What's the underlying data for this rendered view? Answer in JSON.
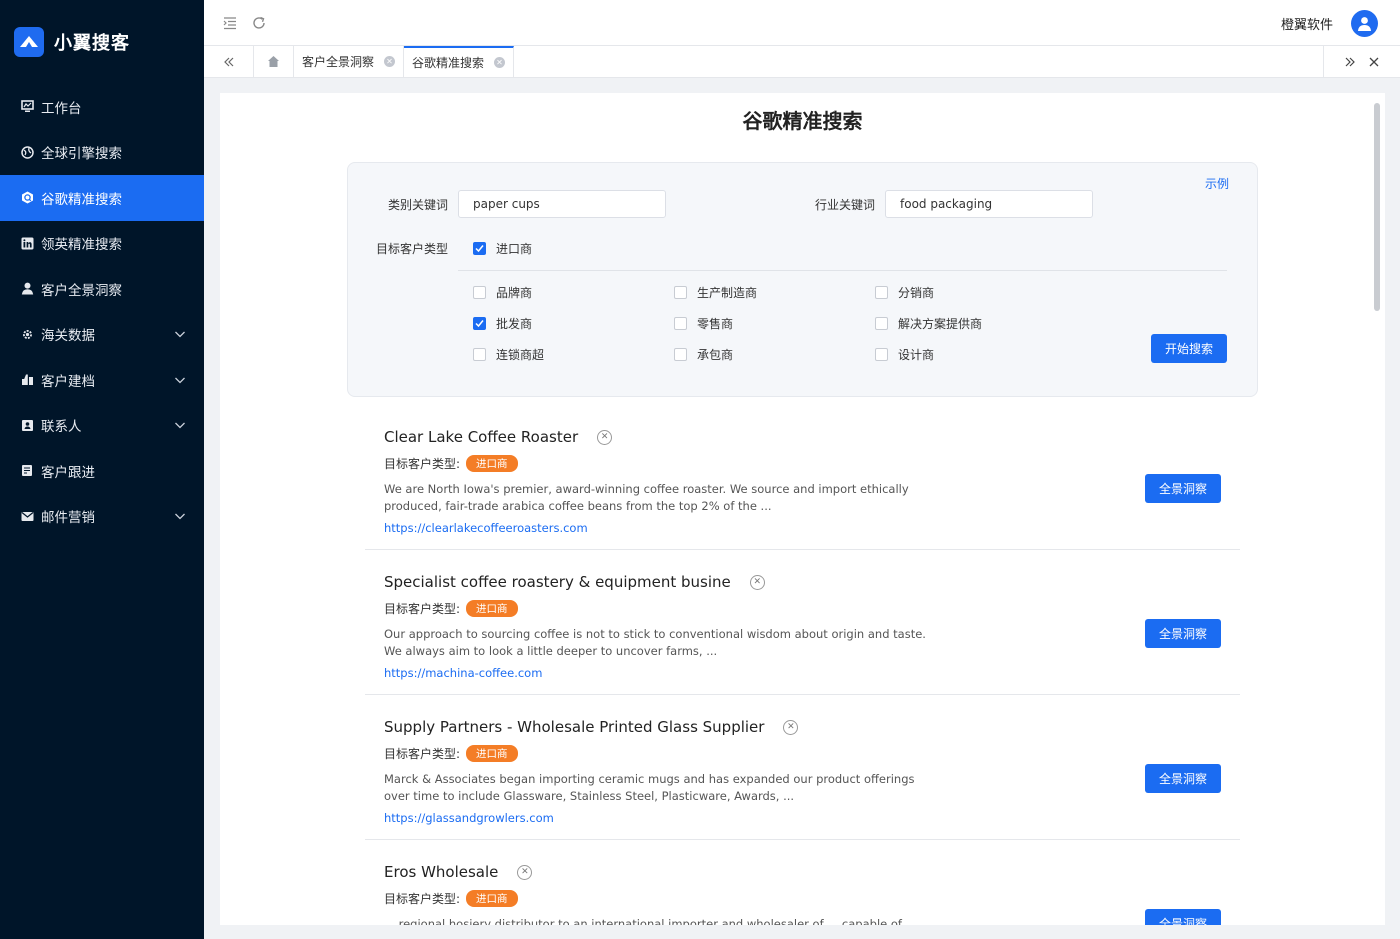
{
  "app": {
    "name": "小翼搜客",
    "company": "橙翼软件"
  },
  "sidebar": {
    "items": [
      {
        "label": "工作台",
        "icon": "monitor-icon",
        "expandable": false,
        "active": false
      },
      {
        "label": "全球引擎搜索",
        "icon": "globe-icon",
        "expandable": false,
        "active": false
      },
      {
        "label": "谷歌精准搜索",
        "icon": "google-icon",
        "expandable": false,
        "active": true
      },
      {
        "label": "领英精准搜索",
        "icon": "linkedin-icon",
        "expandable": false,
        "active": false
      },
      {
        "label": "客户全景洞察",
        "icon": "user-icon",
        "expandable": false,
        "active": false
      },
      {
        "label": "海关数据",
        "icon": "gear-icon",
        "expandable": true,
        "active": false
      },
      {
        "label": "客户建档",
        "icon": "archive-icon",
        "expandable": true,
        "active": false
      },
      {
        "label": "联系人",
        "icon": "contact-icon",
        "expandable": true,
        "active": false
      },
      {
        "label": "客户跟进",
        "icon": "follow-icon",
        "expandable": false,
        "active": false
      },
      {
        "label": "邮件营销",
        "icon": "mail-icon",
        "expandable": true,
        "active": false
      }
    ]
  },
  "tabs": [
    {
      "label": "客户全景洞察",
      "active": false
    },
    {
      "label": "谷歌精准搜索",
      "active": true
    }
  ],
  "page": {
    "title": "谷歌精准搜索",
    "example_link": "示例"
  },
  "form": {
    "category_label": "类别关键词",
    "category_value": "paper cups",
    "industry_label": "行业关键词",
    "industry_value": "food packaging",
    "target_label": "目标客户类型",
    "primary_type": {
      "label": "进口商",
      "checked": true
    },
    "types": [
      {
        "label": "品牌商",
        "checked": false
      },
      {
        "label": "生产制造商",
        "checked": false
      },
      {
        "label": "分销商",
        "checked": false
      },
      {
        "label": "批发商",
        "checked": true
      },
      {
        "label": "零售商",
        "checked": false
      },
      {
        "label": "解决方案提供商",
        "checked": false
      },
      {
        "label": "连锁商超",
        "checked": false
      },
      {
        "label": "承包商",
        "checked": false
      },
      {
        "label": "设计商",
        "checked": false
      }
    ],
    "search_button": "开始搜索"
  },
  "results": [
    {
      "title": "Clear Lake Coffee Roaster",
      "type_label": "目标客户类型:",
      "badge": "进口商",
      "desc": "We are North Iowa's premier, award-winning coffee roaster. We source and import ethically produced, fair-trade arabica coffee beans from the top 2% of the ...",
      "url": "https://clearlakecoffeeroasters.com",
      "button": "全景洞察"
    },
    {
      "title": "Specialist coffee roastery & equipment busine",
      "type_label": "目标客户类型:",
      "badge": "进口商",
      "desc": "Our approach to sourcing coffee is not to stick to conventional wisdom about origin and taste. We always aim to look a little deeper to uncover farms, ...",
      "url": "https://machina-coffee.com",
      "button": "全景洞察"
    },
    {
      "title": "Supply Partners - Wholesale Printed Glass Supplier",
      "type_label": "目标客户类型:",
      "badge": "进口商",
      "desc": "Marck & Associates began importing ceramic mugs and has expanded our product offerings over time to include Glassware, Stainless Steel, Plasticware, Awards, ...",
      "url": "https://glassandgrowlers.com",
      "button": "全景洞察"
    },
    {
      "title": "Eros Wholesale",
      "type_label": "目标客户类型:",
      "badge": "进口商",
      "desc": "... regional hosiery distributor to an international importer and wholesaler of ... capable of importing",
      "url": "",
      "button": "全景洞察"
    }
  ],
  "colors": {
    "sidebar_bg": "#001529",
    "primary": "#1b6cf2",
    "badge": "#f47d26"
  }
}
